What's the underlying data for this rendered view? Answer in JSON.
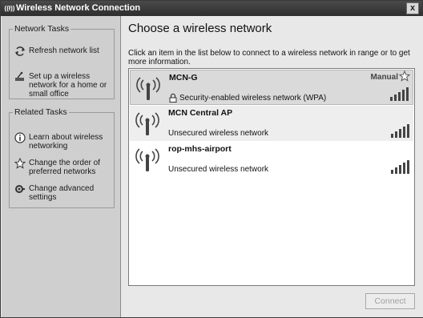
{
  "window": {
    "title": "Wireless Network Connection",
    "close_glyph": "x",
    "title_icon_glyph": "((ł))"
  },
  "sidebar": {
    "network_tasks": {
      "title": "Network Tasks",
      "items": [
        {
          "label": "Refresh network list",
          "icon": "refresh-icon"
        },
        {
          "label": "Set up a wireless network for a home or small office",
          "icon": "setup-network-icon"
        }
      ]
    },
    "related_tasks": {
      "title": "Related Tasks",
      "items": [
        {
          "label": "Learn about wireless networking",
          "icon": "info-icon"
        },
        {
          "label": "Change the order of preferred networks",
          "icon": "star-icon"
        },
        {
          "label": "Change advanced settings",
          "icon": "settings-icon"
        }
      ]
    }
  },
  "main": {
    "heading": "Choose a wireless network",
    "instructions": "Click an item in the list below to connect to a wireless network in range or to get more information.",
    "networks": [
      {
        "name": "MCN-G",
        "status": "Security-enabled wireless network (WPA)",
        "secured": true,
        "manual_label": "Manual",
        "signal_bars": 5,
        "selected": true
      },
      {
        "name": "MCN Central AP",
        "status": "Unsecured wireless network",
        "secured": false,
        "signal_bars": 5
      },
      {
        "name": "rop-mhs-airport",
        "status": "Unsecured wireless network",
        "secured": false,
        "signal_bars": 5
      }
    ],
    "connect_label": "Connect"
  }
}
